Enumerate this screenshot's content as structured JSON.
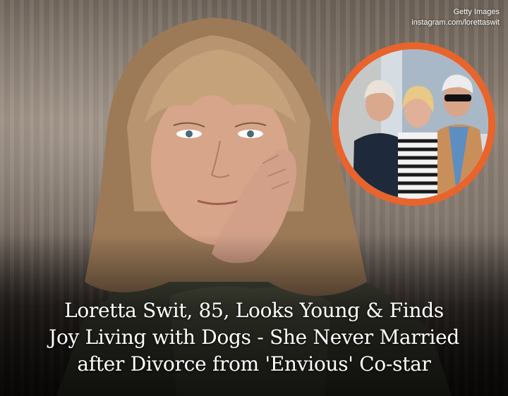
{
  "credit": {
    "line1": "Getty Images",
    "line2": "instagram.com/lorettaswit"
  },
  "headline": {
    "line1": "Loretta Swit, 85, Looks Young & Finds",
    "line2": "Joy Living with Dogs - She Never Married",
    "line3": "after Divorce from 'Envious' Co-star"
  },
  "colors": {
    "inset_ring": "#e8642c",
    "headline_text": "#ffffff"
  }
}
